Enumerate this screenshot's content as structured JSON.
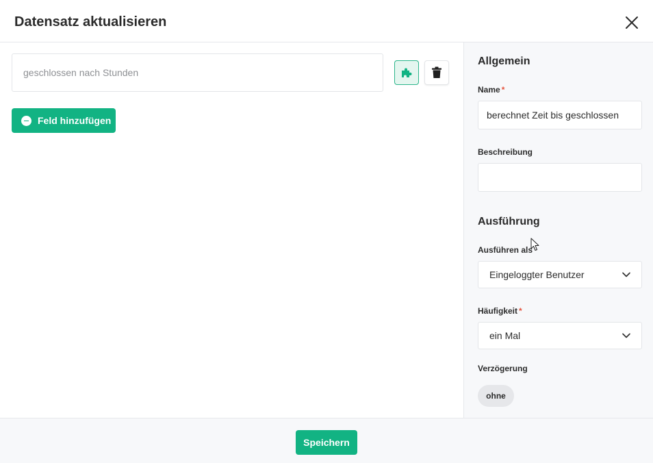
{
  "dialog": {
    "title": "Datensatz aktualisieren"
  },
  "fields": {
    "input_value": "geschlossen nach Stunden",
    "add_field_label": "Feld hinzufügen"
  },
  "general": {
    "section_title": "Allgemein",
    "name_label": "Name",
    "name_required_mark": "*",
    "name_value": "berechnet Zeit bis geschlossen",
    "description_label": "Beschreibung",
    "description_value": ""
  },
  "execution": {
    "section_title": "Ausführung",
    "run_as_label": "Ausführen als",
    "run_as_value": "Eingeloggter Benutzer",
    "frequency_label": "Häufigkeit",
    "frequency_required_mark": "*",
    "frequency_value": "ein Mal",
    "delay_label": "Verzögerung",
    "delay_value": "ohne"
  },
  "footer": {
    "save_label": "Speichern"
  },
  "icons": {
    "close": "close-icon",
    "plugin": "puzzle-icon",
    "delete": "trash-icon",
    "add": "plus-circle-icon",
    "dropdown": "chevron-down-icon",
    "cursor": "mouse-cursor-icon"
  },
  "colors": {
    "accent": "#12b383",
    "required": "#e5533d",
    "panel_bg": "#f7f8fa"
  }
}
